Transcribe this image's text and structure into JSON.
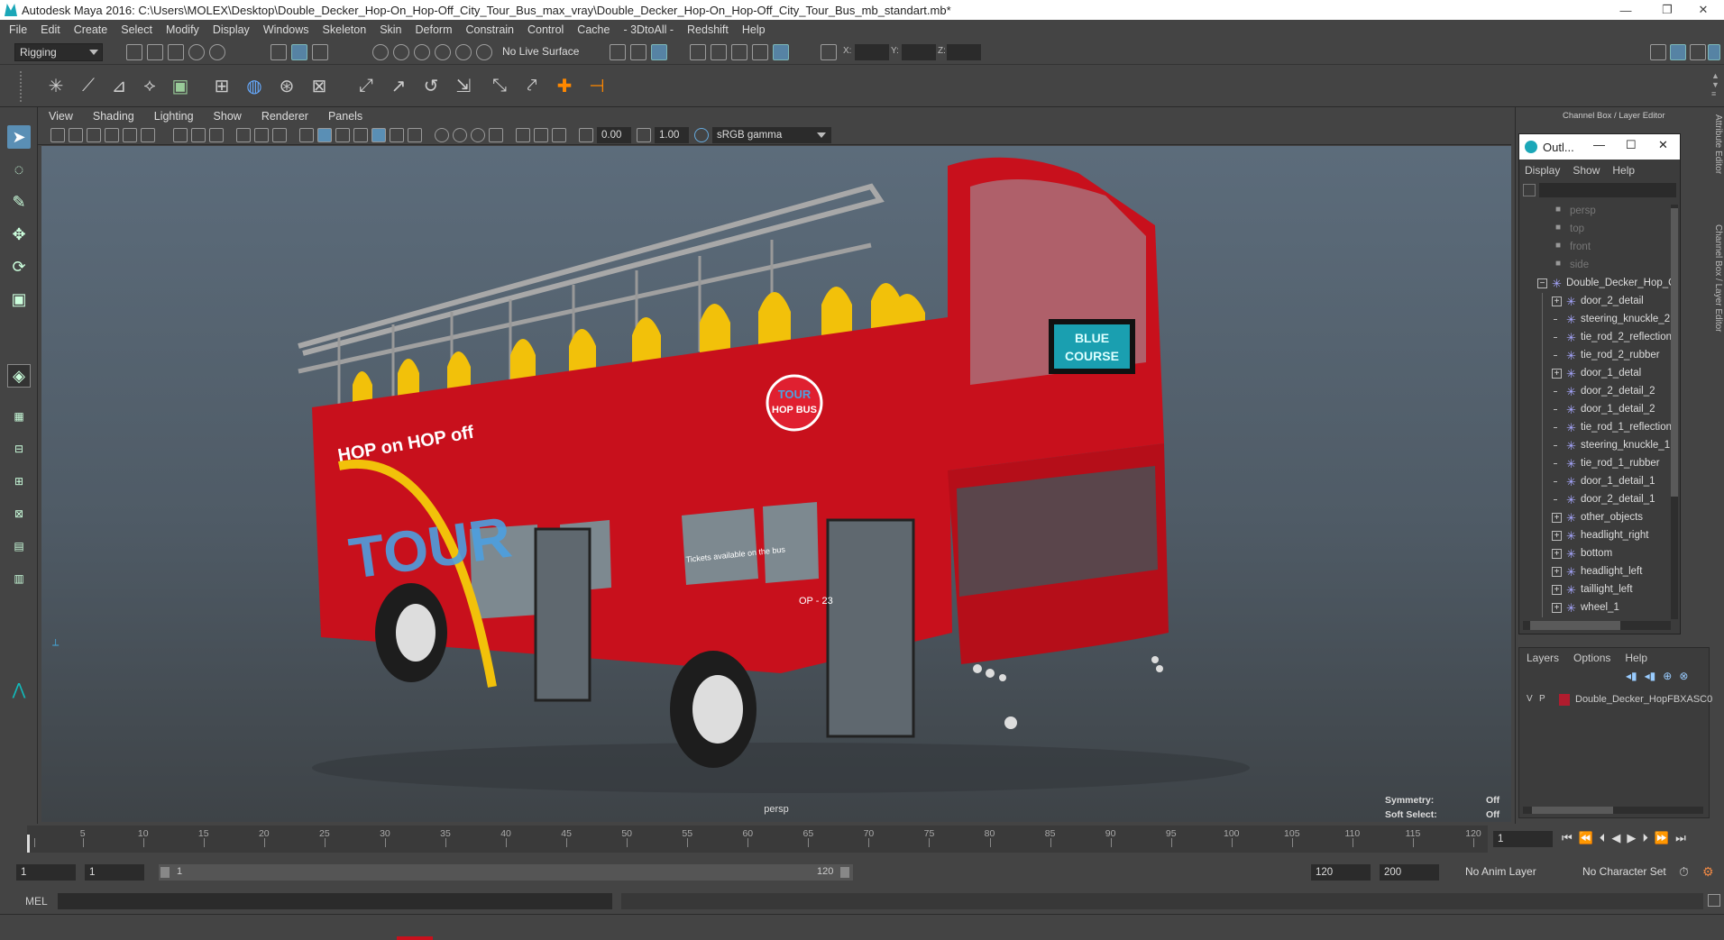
{
  "window": {
    "title": "Autodesk Maya 2016: C:\\Users\\MOLEX\\Desktop\\Double_Decker_Hop-On_Hop-Off_City_Tour_Bus_max_vray\\Double_Decker_Hop-On_Hop-Off_City_Tour_Bus_mb_standart.mb*",
    "minimize": "—",
    "restore": "❐",
    "close": "✕"
  },
  "menubar": [
    "File",
    "Edit",
    "Create",
    "Select",
    "Modify",
    "Display",
    "Windows",
    "Skeleton",
    "Skin",
    "Deform",
    "Constrain",
    "Control",
    "Cache",
    "- 3DtoAll -",
    "Redshift",
    "Help"
  ],
  "status": {
    "mode": "Rigging",
    "live_surface": "No Live Surface",
    "x_label": "X:",
    "y_label": "Y:",
    "z_label": "Z:"
  },
  "panel_menu": [
    "View",
    "Shading",
    "Lighting",
    "Show",
    "Renderer",
    "Panels"
  ],
  "panel_tools": {
    "exposure": "0.00",
    "gamma": "1.00",
    "color_space": "sRGB gamma"
  },
  "viewport": {
    "camera": "persp",
    "symmetry_label": "Symmetry:",
    "symmetry_value": "Off",
    "soft_select_label": "Soft Select:",
    "soft_select_value": "Off",
    "bus_sign": "BLUE COURSE",
    "bus_logo": "TOUR HOP BUS",
    "bus_side_text": "HOP on HOP off",
    "bus_number": "OP - 23",
    "tickets_text": "Tickets available on the bus",
    "colors": {
      "bus_red": "#c8101c",
      "seat_yellow": "#f2c10a"
    }
  },
  "right_panel": {
    "header": "Channel Box / Layer Editor",
    "side_tabs": [
      "Attribute Editor",
      "Channel Box / Layer Editor"
    ]
  },
  "outliner": {
    "title": "Outl...",
    "menu": [
      "Display",
      "Show",
      "Help"
    ],
    "cameras": [
      "persp",
      "top",
      "front",
      "side"
    ],
    "root": "Double_Decker_Hop_O",
    "items": [
      {
        "name": "door_2_detail",
        "expand": true
      },
      {
        "name": "steering_knuckle_2",
        "expand": false
      },
      {
        "name": "tie_rod_2_reflection",
        "expand": false
      },
      {
        "name": "tie_rod_2_rubber",
        "expand": false
      },
      {
        "name": "door_1_detal",
        "expand": true
      },
      {
        "name": "door_2_detail_2",
        "expand": false
      },
      {
        "name": "door_1_detail_2",
        "expand": false
      },
      {
        "name": "tie_rod_1_reflection",
        "expand": false
      },
      {
        "name": "steering_knuckle_1",
        "expand": false
      },
      {
        "name": "tie_rod_1_rubber",
        "expand": false
      },
      {
        "name": "door_1_detail_1",
        "expand": false
      },
      {
        "name": "door_2_detail_1",
        "expand": false
      },
      {
        "name": "other_objects",
        "expand": true
      },
      {
        "name": "headlight_right",
        "expand": true
      },
      {
        "name": "bottom",
        "expand": true
      },
      {
        "name": "headlight_left",
        "expand": true
      },
      {
        "name": "taillight_left",
        "expand": true
      },
      {
        "name": "wheel_1",
        "expand": true
      }
    ]
  },
  "layers": {
    "menu": [
      "Layers",
      "Options",
      "Help"
    ],
    "layer_v": "V",
    "layer_p": "P",
    "layer_name": "Double_Decker_HopFBXASC0",
    "layer_color": "#b01c2e"
  },
  "timeline": {
    "ticks": [
      "1",
      "5",
      "10",
      "15",
      "20",
      "25",
      "30",
      "35",
      "40",
      "45",
      "50",
      "55",
      "60",
      "65",
      "70",
      "75",
      "80",
      "85",
      "90",
      "95",
      "100",
      "105",
      "110",
      "115",
      "120"
    ],
    "current_frame": "1"
  },
  "range": {
    "start": "1",
    "playback_start": "1",
    "slider_start": "1",
    "slider_end": "120",
    "playback_end": "120",
    "end": "200",
    "anim_layer": "No Anim Layer",
    "character_set": "No Character Set"
  },
  "cmdline": {
    "label": "MEL"
  }
}
